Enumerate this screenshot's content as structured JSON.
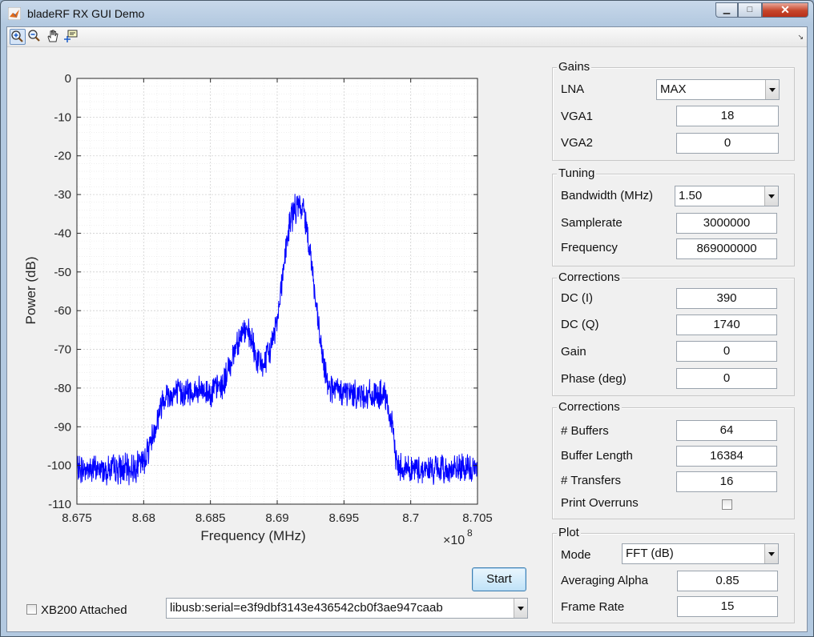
{
  "window": {
    "title": "bladeRF RX GUI Demo",
    "close_glyph": "✕",
    "max_glyph": "□",
    "min_glyph": "▁"
  },
  "toolbar": {
    "icons": [
      "zoom-in-icon",
      "zoom-out-icon",
      "pan-hand-icon",
      "data-cursor-icon"
    ],
    "corner_glyph": "↘"
  },
  "plot": {
    "ylabel": "Power (dB)",
    "xlabel": "Frequency (MHz)",
    "exponent_label": "×10",
    "exponent_power": "8",
    "x_ticks": [
      "8.675",
      "8.68",
      "8.685",
      "8.69",
      "8.695",
      "8.7",
      "8.705"
    ],
    "y_ticks": [
      "0",
      "-10",
      "-20",
      "-30",
      "-40",
      "-50",
      "-60",
      "-70",
      "-80",
      "-90",
      "-100",
      "-110"
    ],
    "line_color": "#0000ff"
  },
  "chart_data": {
    "type": "line",
    "title": "",
    "xlabel": "Frequency (MHz)",
    "ylabel": "Power (dB)",
    "xlim": [
      867500000,
      870500000
    ],
    "ylim": [
      -110,
      0
    ],
    "x_scale_label": "×10^8",
    "grid": true,
    "series": [
      {
        "x": [
          867500000,
          867900000,
          868000000,
          868080000,
          868150000,
          868300000,
          868500000,
          868600000,
          868700000,
          868750000,
          868800000,
          868850000,
          868900000,
          868950000,
          869000000,
          869050000,
          869100000,
          869150000,
          869200000,
          869250000,
          869300000,
          869350000,
          869400000,
          869450000,
          869500000,
          869700000,
          869800000,
          869850000,
          869900000,
          870000000,
          870500000
        ],
        "y": [
          -101,
          -101,
          -99,
          -91,
          -82,
          -81,
          -81,
          -79,
          -68,
          -65,
          -67,
          -73,
          -74,
          -70,
          -62,
          -48,
          -36,
          -33,
          -34,
          -45,
          -62,
          -75,
          -80,
          -81,
          -81,
          -82,
          -82,
          -88,
          -100,
          -101,
          -101
        ]
      }
    ]
  },
  "gains": {
    "title": "Gains",
    "lna_label": "LNA",
    "lna_value": "MAX",
    "vga1_label": "VGA1",
    "vga1_value": "18",
    "vga2_label": "VGA2",
    "vga2_value": "0"
  },
  "tuning": {
    "title": "Tuning",
    "bandwidth_label": "Bandwidth (MHz)",
    "bandwidth_value": "1.50",
    "samplerate_label": "Samplerate",
    "samplerate_value": "3000000",
    "frequency_label": "Frequency",
    "frequency_value": "869000000"
  },
  "corrections": {
    "title": "Corrections",
    "dci_label": "DC (I)",
    "dci_value": "390",
    "dcq_label": "DC (Q)",
    "dcq_value": "1740",
    "gain_label": "Gain",
    "gain_value": "0",
    "phase_label": "Phase (deg)",
    "phase_value": "0"
  },
  "stream": {
    "title": "Corrections",
    "buffers_label": "# Buffers",
    "buffers_value": "64",
    "buflen_label": "Buffer Length",
    "buflen_value": "16384",
    "transfers_label": "# Transfers",
    "transfers_value": "16",
    "overruns_label": "Print Overruns"
  },
  "plotctl": {
    "title": "Plot",
    "mode_label": "Mode",
    "mode_value": "FFT (dB)",
    "alpha_label": "Averaging Alpha",
    "alpha_value": "0.85",
    "framerate_label": "Frame Rate",
    "framerate_value": "15"
  },
  "bottom": {
    "start_label": "Start",
    "xb200_label": "XB200 Attached",
    "device_value": "libusb:serial=e3f9dbf3143e436542cb0f3ae947caab"
  }
}
